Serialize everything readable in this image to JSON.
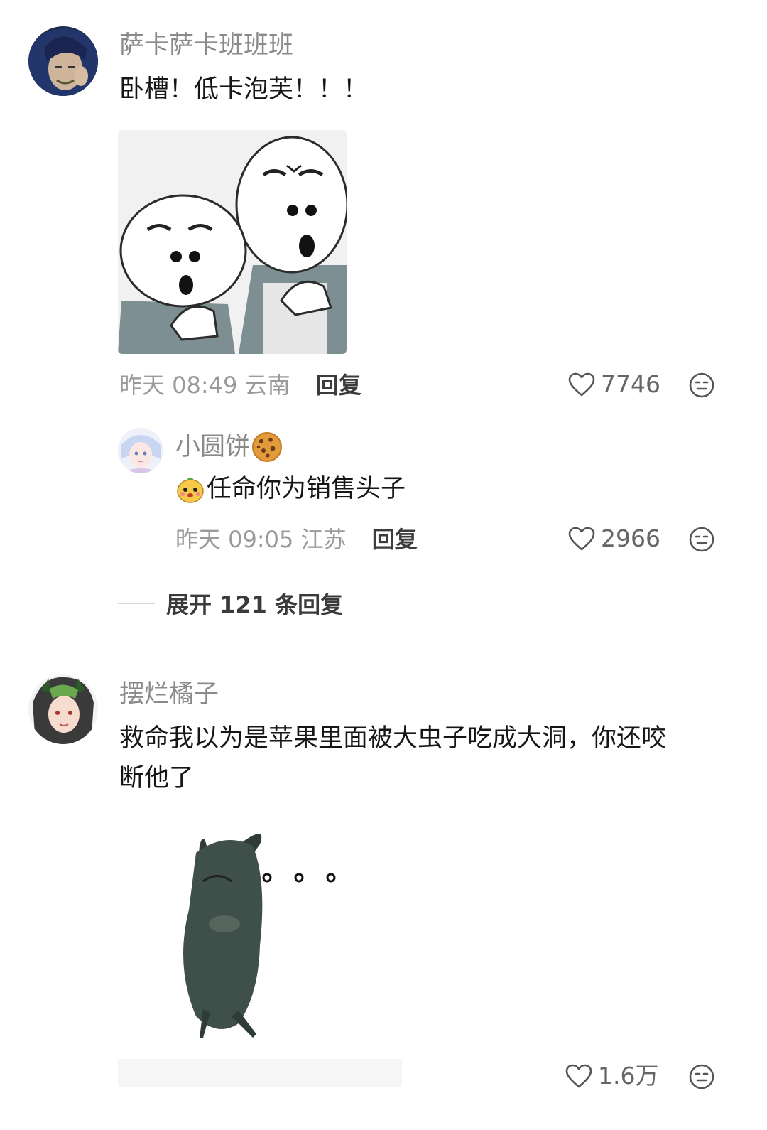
{
  "comments": [
    {
      "username": "萨卡萨卡班班班",
      "text": "卧槽！低卡泡芙！！！",
      "sticker_icon": "thinking-buns-sticker",
      "time": "昨天 08:49",
      "location": "云南",
      "reply_label": "回复",
      "likes": "7746",
      "replies": [
        {
          "username": "小圆饼",
          "username_emoji": "cookie-icon",
          "text": "任命你为销售头子",
          "text_emoji": "mascot-face-icon",
          "time": "昨天 09:05",
          "location": "江苏",
          "reply_label": "回复",
          "likes": "2966"
        }
      ],
      "expand_label": "展开 121 条回复"
    },
    {
      "username": "摆烂橘子",
      "text_line1": "救命我以为是苹果里面被大虫子吃成大洞，你还咬",
      "text_line2": "断他了",
      "sticker_icon": "green-creature-sticker",
      "likes": "1.6万"
    }
  ],
  "icons": {
    "like": "heart-outline-icon",
    "dislike": "meh-face-icon"
  },
  "colors": {
    "username": "#8a8a8a",
    "meta": "#9a9a9a",
    "text": "#161616"
  }
}
